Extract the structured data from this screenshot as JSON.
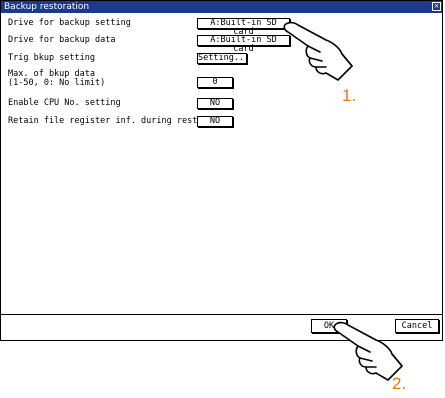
{
  "window": {
    "title": "Backup restoration"
  },
  "settings": {
    "drive_backup_setting": {
      "label": "Drive for backup setting",
      "value": "A:Built-in SD card"
    },
    "drive_backup_data": {
      "label": "Drive for backup data",
      "value": "A:Built-in SD card"
    },
    "trig_bkup": {
      "label": "Trig bkup setting",
      "value": "Setting..."
    },
    "max_bkup": {
      "label_line1": "Max. of bkup data",
      "label_line2": "(1-50, 0: No limit)",
      "value": "0"
    },
    "enable_cpu": {
      "label": "Enable CPU No. setting",
      "value": "NO"
    },
    "retain_file": {
      "label": "Retain file register inf. during restor",
      "value": "NO"
    }
  },
  "buttons": {
    "ok": "OK",
    "cancel": "Cancel"
  },
  "callouts": {
    "step1": "1.",
    "step2": "2."
  },
  "colors": {
    "titlebar": "#1a3a8f",
    "callout": "#e07a10"
  },
  "icons": {
    "pointer": "hand-pointer-icon"
  }
}
